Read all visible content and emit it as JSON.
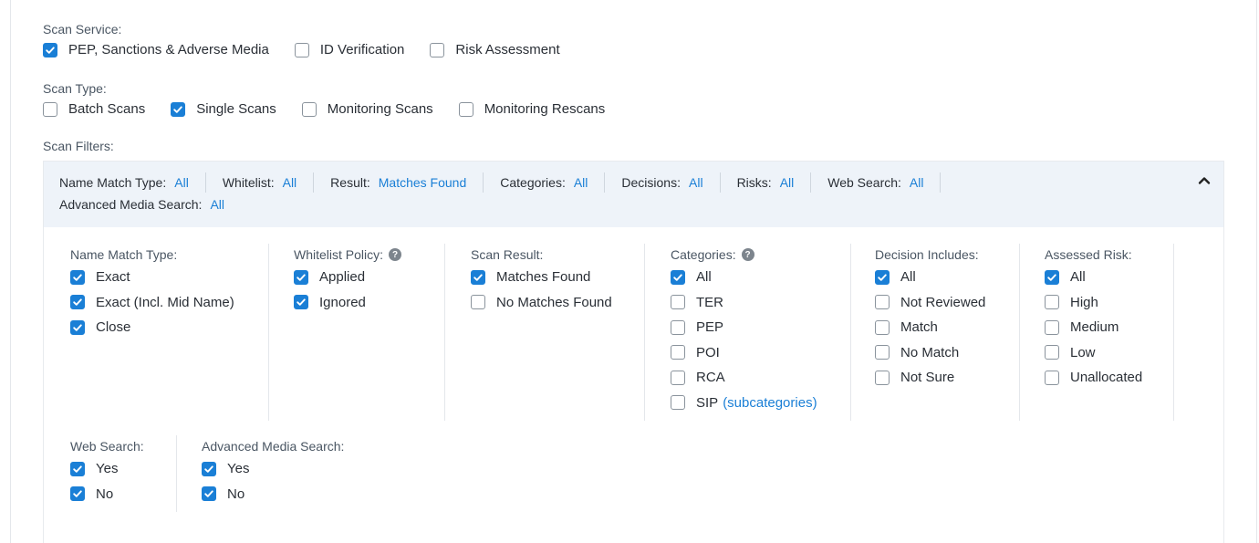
{
  "scan_service": {
    "label": "Scan Service:",
    "options": [
      {
        "label": "PEP, Sanctions & Adverse Media",
        "checked": true
      },
      {
        "label": "ID Verification",
        "checked": false
      },
      {
        "label": "Risk Assessment",
        "checked": false
      }
    ]
  },
  "scan_type": {
    "label": "Scan Type:",
    "options": [
      {
        "label": "Batch Scans",
        "checked": false
      },
      {
        "label": "Single Scans",
        "checked": true
      },
      {
        "label": "Monitoring Scans",
        "checked": false
      },
      {
        "label": "Monitoring Rescans",
        "checked": false
      }
    ]
  },
  "scan_filters": {
    "label": "Scan Filters:",
    "summary": [
      {
        "key": "Name Match Type:",
        "value": "All"
      },
      {
        "key": "Whitelist:",
        "value": "All"
      },
      {
        "key": "Result:",
        "value": "Matches Found"
      },
      {
        "key": "Categories:",
        "value": "All"
      },
      {
        "key": "Decisions:",
        "value": "All"
      },
      {
        "key": "Risks:",
        "value": "All"
      },
      {
        "key": "Web Search:",
        "value": "All"
      },
      {
        "key": "Advanced Media Search:",
        "value": "All"
      }
    ],
    "groups": {
      "name_match_type": {
        "header": "Name Match Type:",
        "options": [
          {
            "label": "Exact",
            "checked": true
          },
          {
            "label": "Exact (Incl. Mid Name)",
            "checked": true
          },
          {
            "label": "Close",
            "checked": true
          }
        ]
      },
      "whitelist_policy": {
        "header": "Whitelist Policy:",
        "help_icon": "?",
        "options": [
          {
            "label": "Applied",
            "checked": true
          },
          {
            "label": "Ignored",
            "checked": true
          }
        ]
      },
      "scan_result": {
        "header": "Scan Result:",
        "options": [
          {
            "label": "Matches Found",
            "checked": true
          },
          {
            "label": "No Matches Found",
            "checked": false
          }
        ]
      },
      "categories": {
        "header": "Categories:",
        "help_icon": "?",
        "options": [
          {
            "label": "All",
            "checked": true
          },
          {
            "label": "TER",
            "checked": false
          },
          {
            "label": "PEP",
            "checked": false
          },
          {
            "label": "POI",
            "checked": false
          },
          {
            "label": "RCA",
            "checked": false
          },
          {
            "label": "SIP",
            "checked": false
          }
        ],
        "subcategories_link": "(subcategories)"
      },
      "decision_includes": {
        "header": "Decision Includes:",
        "options": [
          {
            "label": "All",
            "checked": true
          },
          {
            "label": "Not Reviewed",
            "checked": false
          },
          {
            "label": "Match",
            "checked": false
          },
          {
            "label": "No Match",
            "checked": false
          },
          {
            "label": "Not Sure",
            "checked": false
          }
        ]
      },
      "assessed_risk": {
        "header": "Assessed Risk:",
        "options": [
          {
            "label": "All",
            "checked": true
          },
          {
            "label": "High",
            "checked": false
          },
          {
            "label": "Medium",
            "checked": false
          },
          {
            "label": "Low",
            "checked": false
          },
          {
            "label": "Unallocated",
            "checked": false
          }
        ]
      },
      "web_search": {
        "header": "Web Search:",
        "options": [
          {
            "label": "Yes",
            "checked": true
          },
          {
            "label": "No",
            "checked": true
          }
        ]
      },
      "advanced_media_search": {
        "header": "Advanced Media Search:",
        "options": [
          {
            "label": "Yes",
            "checked": true
          },
          {
            "label": "No",
            "checked": true
          }
        ]
      }
    }
  },
  "colors": {
    "accent": "#1a7fd6",
    "summary_bg": "#eef3f9",
    "divider": "#e4e7eb"
  },
  "icons": {
    "collapse": "chevron-up-icon",
    "check": "check-icon",
    "help": "question-circle-icon"
  }
}
